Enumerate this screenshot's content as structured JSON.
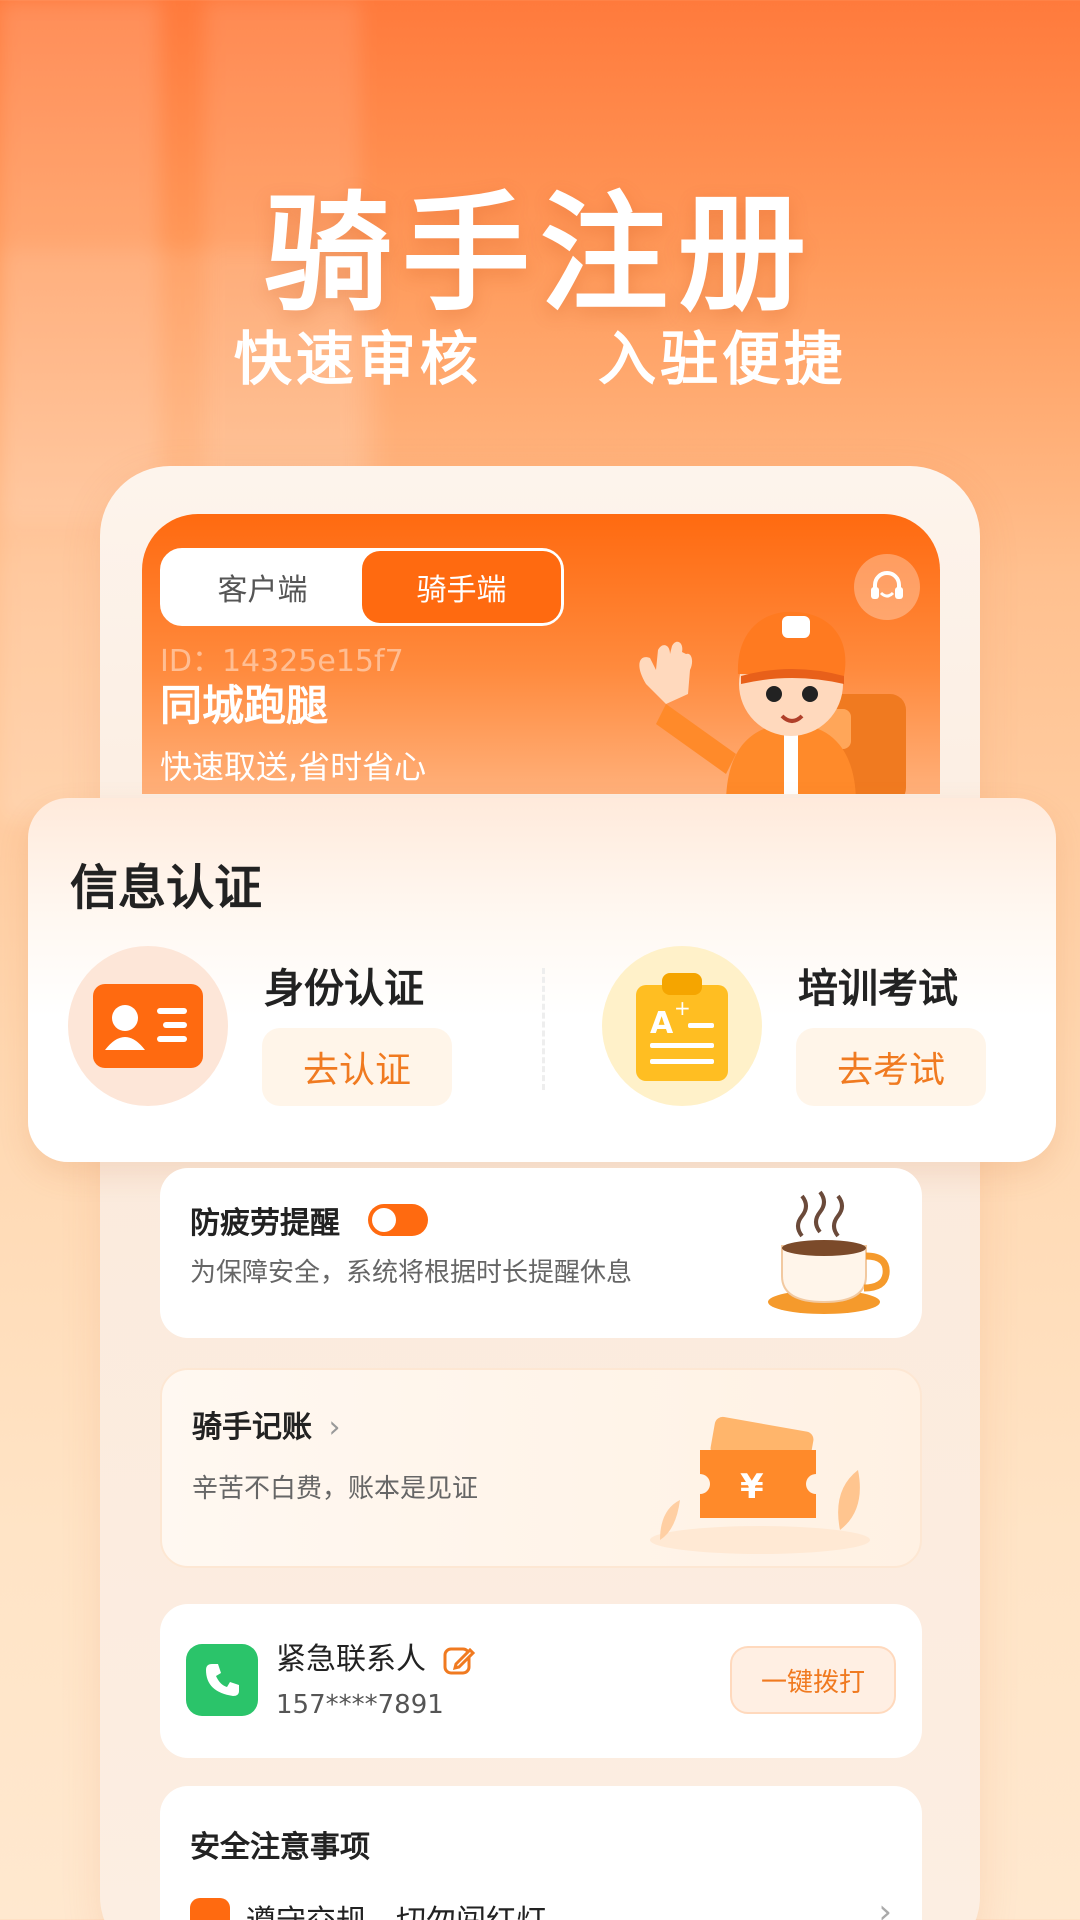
{
  "hero": {
    "title": "骑手注册",
    "subtitle_left": "快速审核",
    "subtitle_right": "入驻便捷"
  },
  "banner": {
    "tabs": [
      {
        "label": "客户端",
        "active": false
      },
      {
        "label": "骑手端",
        "active": true
      }
    ],
    "id_text": "ID：14325e15f7",
    "title": "同城跑腿",
    "subtitle": "快速取送,省时省心"
  },
  "info_auth": {
    "title": "信息认证",
    "identity": {
      "name": "身份认证",
      "button": "去认证"
    },
    "exam": {
      "name": "培训考试",
      "button": "去考试"
    }
  },
  "fatigue": {
    "title": "防疲劳提醒",
    "desc": "为保障安全，系统将根据时长提醒休息",
    "toggle_on": true
  },
  "ledger": {
    "title": "骑手记账",
    "desc": "辛苦不白费，账本是见证"
  },
  "contact": {
    "title": "紧急联系人",
    "phone": "157****7891",
    "call_label": "一键拨打"
  },
  "safety": {
    "title": "安全注意事项",
    "item1": "遵守交规，切勿闯红灯"
  },
  "colors": {
    "accent": "#ff6a10",
    "accent_text": "#f07a20",
    "green": "#2bc46a"
  }
}
